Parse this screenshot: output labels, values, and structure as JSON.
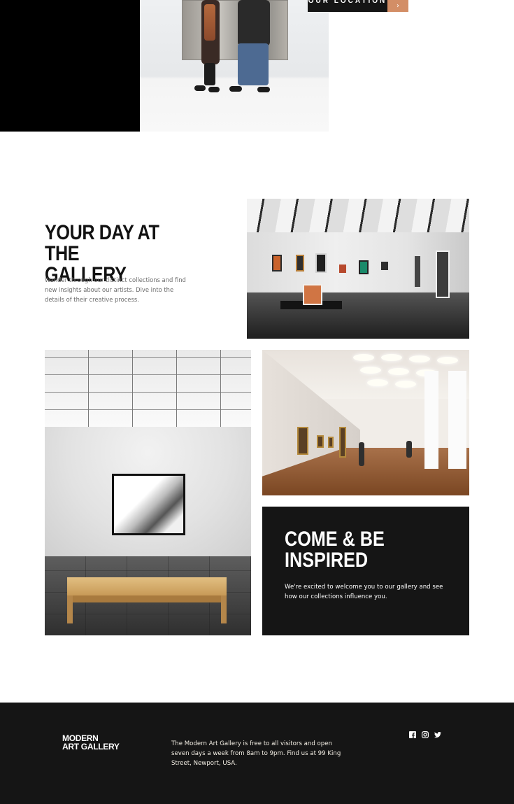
{
  "hero": {
    "location_button": {
      "label": "OUR LOCATION",
      "arrow": "›"
    }
  },
  "intro": {
    "title_line1": "Your day at the",
    "title_line2": "gallery",
    "body": "Wander through our distinct collections and find new insights about our artists. Dive into the details of their creative process."
  },
  "cta_card": {
    "title_line1": "Come & be",
    "title_line2": "inspired",
    "body": "We're excited to welcome you to our gallery and see how our collections influence you."
  },
  "footer": {
    "logo_line1": "Modern",
    "logo_line2": "Art Gallery",
    "info": "The Modern Art Gallery is free to all visitors and open seven days a week from 8am to 9pm. Find us at 99 King Street, Newport, USA.",
    "social": [
      {
        "icon": "facebook-icon"
      },
      {
        "icon": "instagram-icon"
      },
      {
        "icon": "twitter-icon"
      }
    ]
  },
  "colors": {
    "accent": "#d38e66",
    "dark": "#151515",
    "text": "#121212",
    "muted": "#6b6b6b",
    "footer_text": "#f3eee4"
  }
}
